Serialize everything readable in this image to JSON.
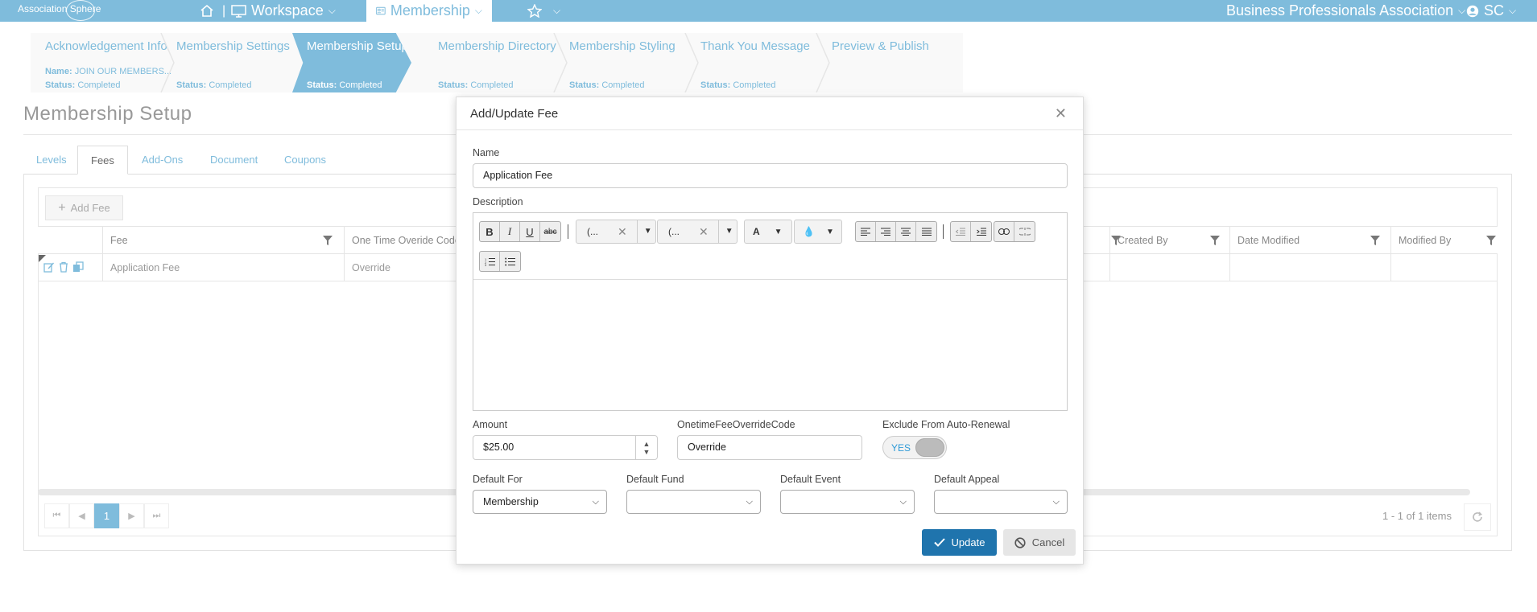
{
  "topnav": {
    "logo": "Association Sphere",
    "workspace": "Workspace",
    "membership": "Membership",
    "org": "Business Professionals Association",
    "user": "SC"
  },
  "wizard": [
    {
      "title": "Acknowledgement Info",
      "name_label": "Name:",
      "name_value": "JOIN OUR MEMBERS...",
      "status_label": "Status:",
      "status_value": "Completed"
    },
    {
      "title": "Membership Settings",
      "status_label": "Status:",
      "status_value": "Completed"
    },
    {
      "title": "Membership Setup",
      "status_label": "Status:",
      "status_value": "Completed"
    },
    {
      "title": "Membership Directory",
      "status_label": "Status:",
      "status_value": "Completed"
    },
    {
      "title": "Membership Styling",
      "status_label": "Status:",
      "status_value": "Completed"
    },
    {
      "title": "Thank You Message",
      "status_label": "Status:",
      "status_value": "Completed"
    },
    {
      "title": "Preview & Publish"
    }
  ],
  "page_title": "Membership Setup",
  "tabs": [
    "Levels",
    "Fees",
    "Add-Ons",
    "Document",
    "Coupons"
  ],
  "grid": {
    "add_button": "Add Fee",
    "columns": [
      "Fee",
      "One Time Overide Code",
      "Created By",
      "Date Modified",
      "Modified By"
    ],
    "rows": [
      {
        "fee": "Application Fee",
        "override": "Override"
      }
    ],
    "pager_current": "1",
    "items_text": "1 - 1 of 1 items"
  },
  "modal": {
    "title": "Add/Update Fee",
    "name_label": "Name",
    "name_value": "Application Fee",
    "description_label": "Description",
    "font_select": "(...",
    "size_select": "(...",
    "amount_label": "Amount",
    "amount_value": "$25.00",
    "override_label": "OnetimeFeeOverrideCode",
    "override_value": "Override",
    "exclude_label": "Exclude From Auto-Renewal",
    "exclude_toggle": "YES",
    "default_for_label": "Default For",
    "default_for_value": "Membership",
    "default_fund_label": "Default Fund",
    "default_fund_value": "",
    "default_event_label": "Default Event",
    "default_event_value": "",
    "default_appeal_label": "Default Appeal",
    "default_appeal_value": "",
    "update": "Update",
    "cancel": "Cancel"
  },
  "colors": {
    "nav": "#7fbcdc",
    "primary_button": "#1f74ad",
    "toggle_text": "#2f9bd7"
  }
}
